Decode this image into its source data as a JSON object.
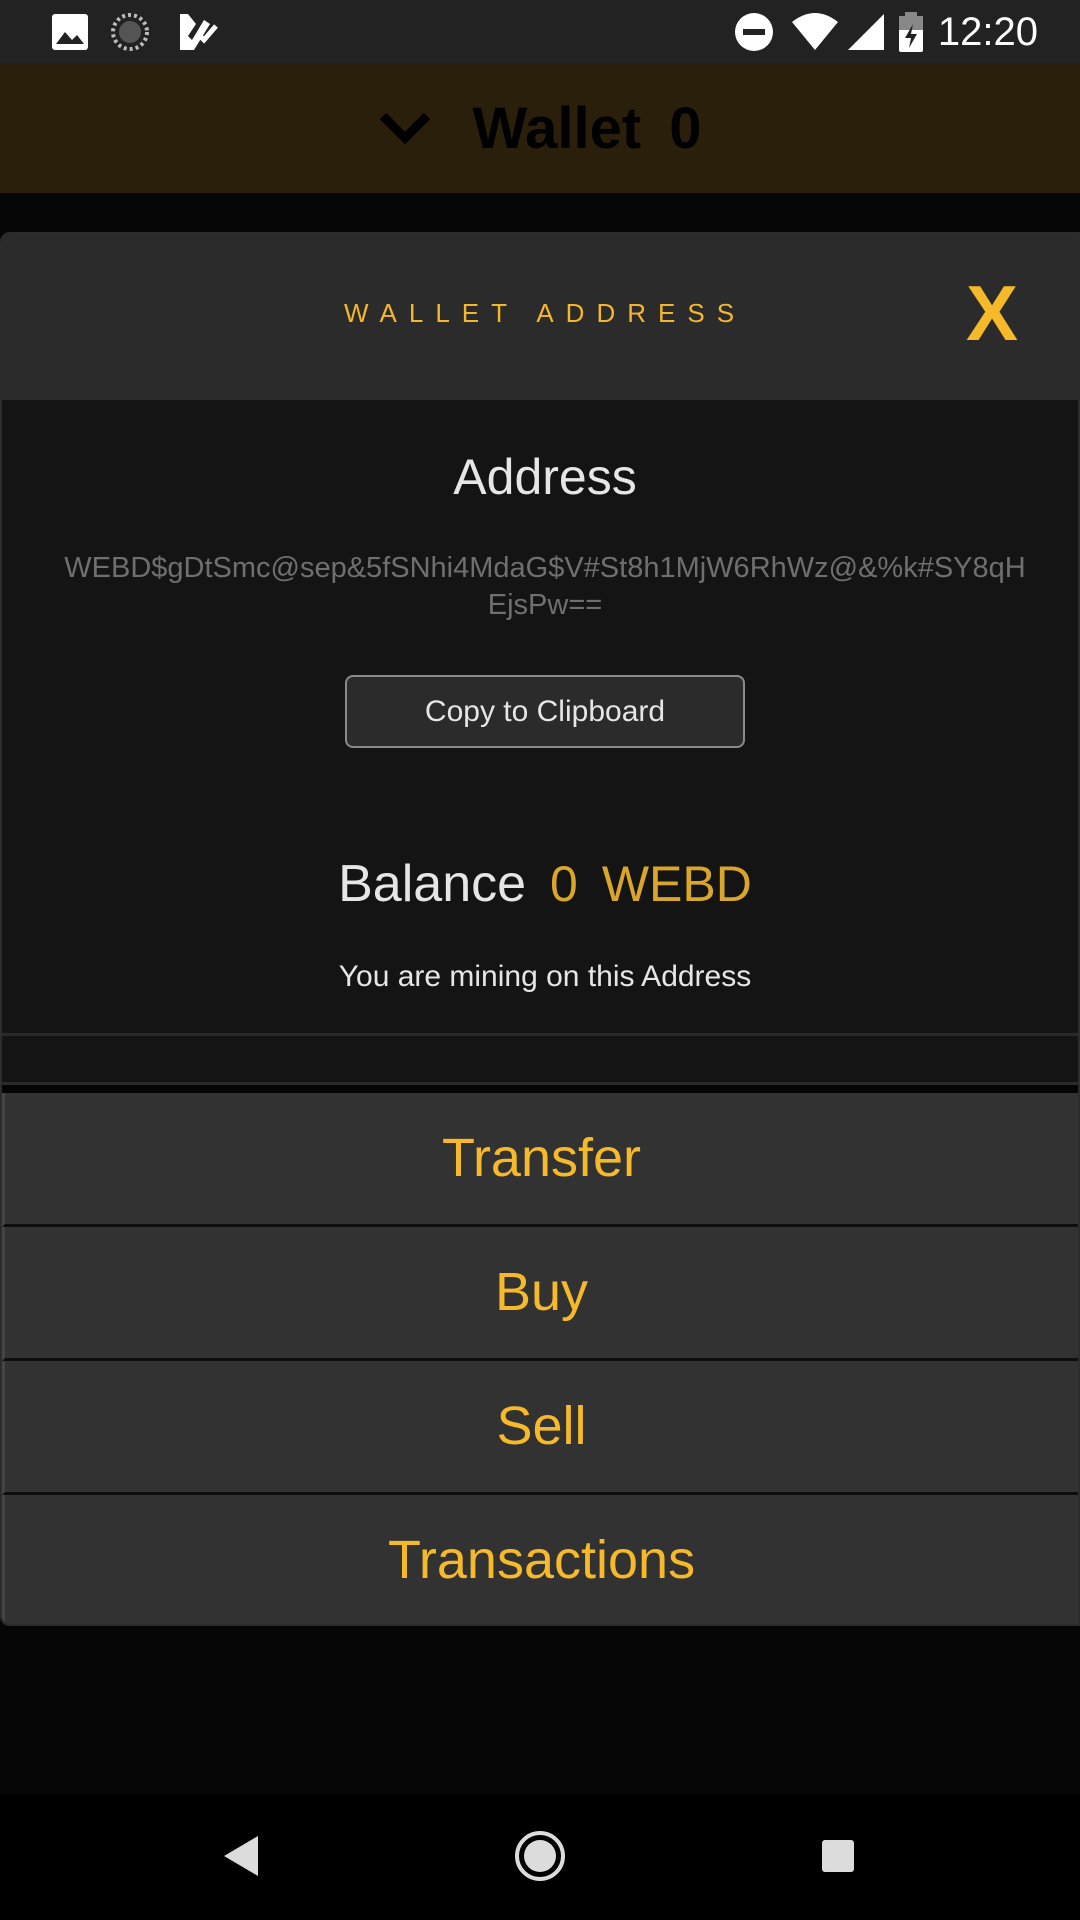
{
  "status_bar": {
    "time": "12:20",
    "left_icons": [
      "image-icon",
      "sync-icon",
      "checklist-icon"
    ],
    "right_icons": [
      "do-not-disturb-icon",
      "wifi-icon",
      "signal-icon",
      "battery-icon"
    ]
  },
  "header": {
    "title": "Wallet",
    "count": "0"
  },
  "modal": {
    "title": "WALLET ADDRESS",
    "close_label": "X",
    "address_label": "Address",
    "address_value": "WEBD$gDtSmc@sep&5fSNhi4MdaG$V#St8h1MjW6RhWz@&%k#SY8qHEjsPw==",
    "copy_label": "Copy to Clipboard",
    "balance_label": "Balance",
    "balance_value": "0",
    "balance_unit": "WEBD",
    "mining_note": "You are mining on this Address",
    "actions": [
      {
        "label": "Transfer"
      },
      {
        "label": "Buy"
      },
      {
        "label": "Sell"
      },
      {
        "label": "Transactions"
      }
    ]
  },
  "nav_bar": {
    "buttons": [
      "back-icon",
      "home-icon",
      "recents-icon"
    ]
  },
  "colors": {
    "accent": "#f5b92a",
    "header_bg": "#2a1f0b",
    "panel_bg": "#141414",
    "button_bg": "#323232"
  }
}
